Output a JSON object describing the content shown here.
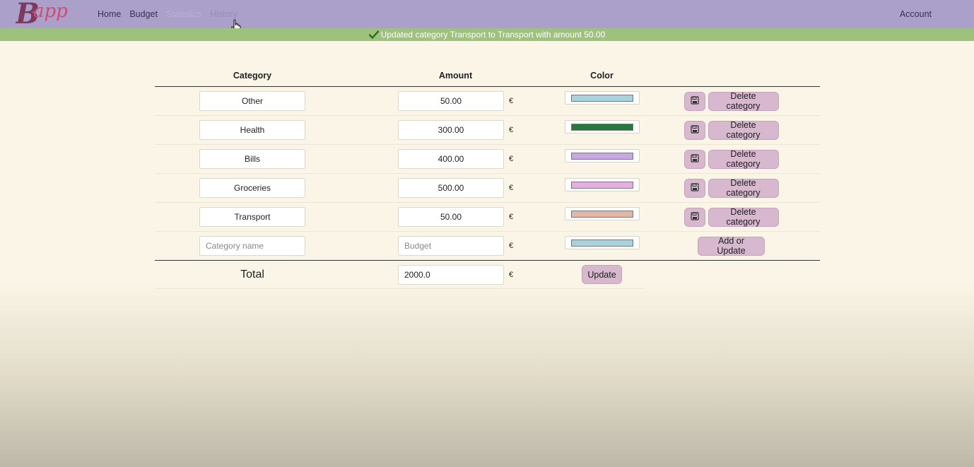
{
  "nav": {
    "brand": "Bapp",
    "links": [
      {
        "label": "Home",
        "state": "normal"
      },
      {
        "label": "Budget",
        "state": "normal"
      },
      {
        "label": "Statistics",
        "state": "faded"
      },
      {
        "label": "History",
        "state": "hover"
      }
    ],
    "account": "Account"
  },
  "alert": {
    "icon": "check-icon",
    "message": "Updated category Transport to Transport with amount 50.00"
  },
  "table": {
    "headers": {
      "category": "Category",
      "amount": "Amount",
      "color": "Color"
    },
    "currency": "€",
    "rows": [
      {
        "category": "Other",
        "amount": "50.00",
        "color": "#a8d3dc"
      },
      {
        "category": "Health",
        "amount": "300.00",
        "color": "#237a3a"
      },
      {
        "category": "Bills",
        "amount": "400.00",
        "color": "#c8a8e2"
      },
      {
        "category": "Groceries",
        "amount": "500.00",
        "color": "#e7aee1"
      },
      {
        "category": "Transport",
        "amount": "50.00",
        "color": "#e1b7a8"
      }
    ],
    "delete_label": "Delete category",
    "new_row": {
      "category_placeholder": "Category name",
      "amount_placeholder": "Budget",
      "color": "#a8d3dc",
      "add_label": "Add or Update"
    },
    "total": {
      "label": "Total",
      "value": "2000.0",
      "update_label": "Update"
    }
  },
  "colors": {
    "navbar": "#aba0c9",
    "alert": "#9ec17d",
    "button": "#d7b8cf",
    "page": "#fbf5e7"
  }
}
